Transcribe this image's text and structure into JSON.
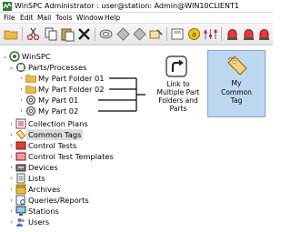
{
  "window": {
    "title": "WinSPC Administrator : user@station: Admin@WIN10CLIENT1"
  },
  "menu": [
    "File",
    "Edit",
    "Mail",
    "Tools",
    "Window",
    "Help"
  ],
  "toolbar_icons": [
    "open-folder-icon",
    "cut-icon",
    "copy-icon",
    "paste-icon",
    "delete-icon",
    "link-icon",
    "diamond-icon",
    "diamond-icon",
    "tag-pen-icon",
    "folder-add-icon",
    "coin-icon",
    "sliders-icon",
    "alarm-icon",
    "alarm-icon",
    "alarm-icon"
  ],
  "tree": {
    "root": "WinSPC",
    "items": [
      {
        "label": "Parts/Processes",
        "icon": "parts-processes-icon"
      },
      {
        "label": "My Part Folder 01",
        "icon": "folder-icon"
      },
      {
        "label": "My Part Folder 02",
        "icon": "folder-icon"
      },
      {
        "label": "My Part 01",
        "icon": "part-icon"
      },
      {
        "label": "My Part 02",
        "icon": "part-icon"
      },
      {
        "label": "Collection Plans",
        "icon": "collection-plans-icon"
      },
      {
        "label": "Common Tags",
        "icon": "common-tags-icon"
      },
      {
        "label": "Control Tests",
        "icon": "control-tests-icon"
      },
      {
        "label": "Control Test Templates",
        "icon": "control-test-templates-icon"
      },
      {
        "label": "Devices",
        "icon": "devices-icon"
      },
      {
        "label": "Lists",
        "icon": "lists-icon"
      },
      {
        "label": "Archives",
        "icon": "archives-icon"
      },
      {
        "label": "Queries/Reports",
        "icon": "queries-reports-icon"
      },
      {
        "label": "Stations",
        "icon": "stations-icon"
      },
      {
        "label": "Users",
        "icon": "users-icon"
      }
    ],
    "selected": "Common Tags"
  },
  "callout": {
    "line1": "Link to",
    "line2": "Multiple Part",
    "line3": "Folders and",
    "line4": "Parts"
  },
  "tag_panel": {
    "line1": "My",
    "line2": "Common",
    "line3": "Tag"
  },
  "colors": {
    "selection": "#dcdcdc",
    "tag_panel_bg": "#bed7f0",
    "link_line": "#000000"
  }
}
